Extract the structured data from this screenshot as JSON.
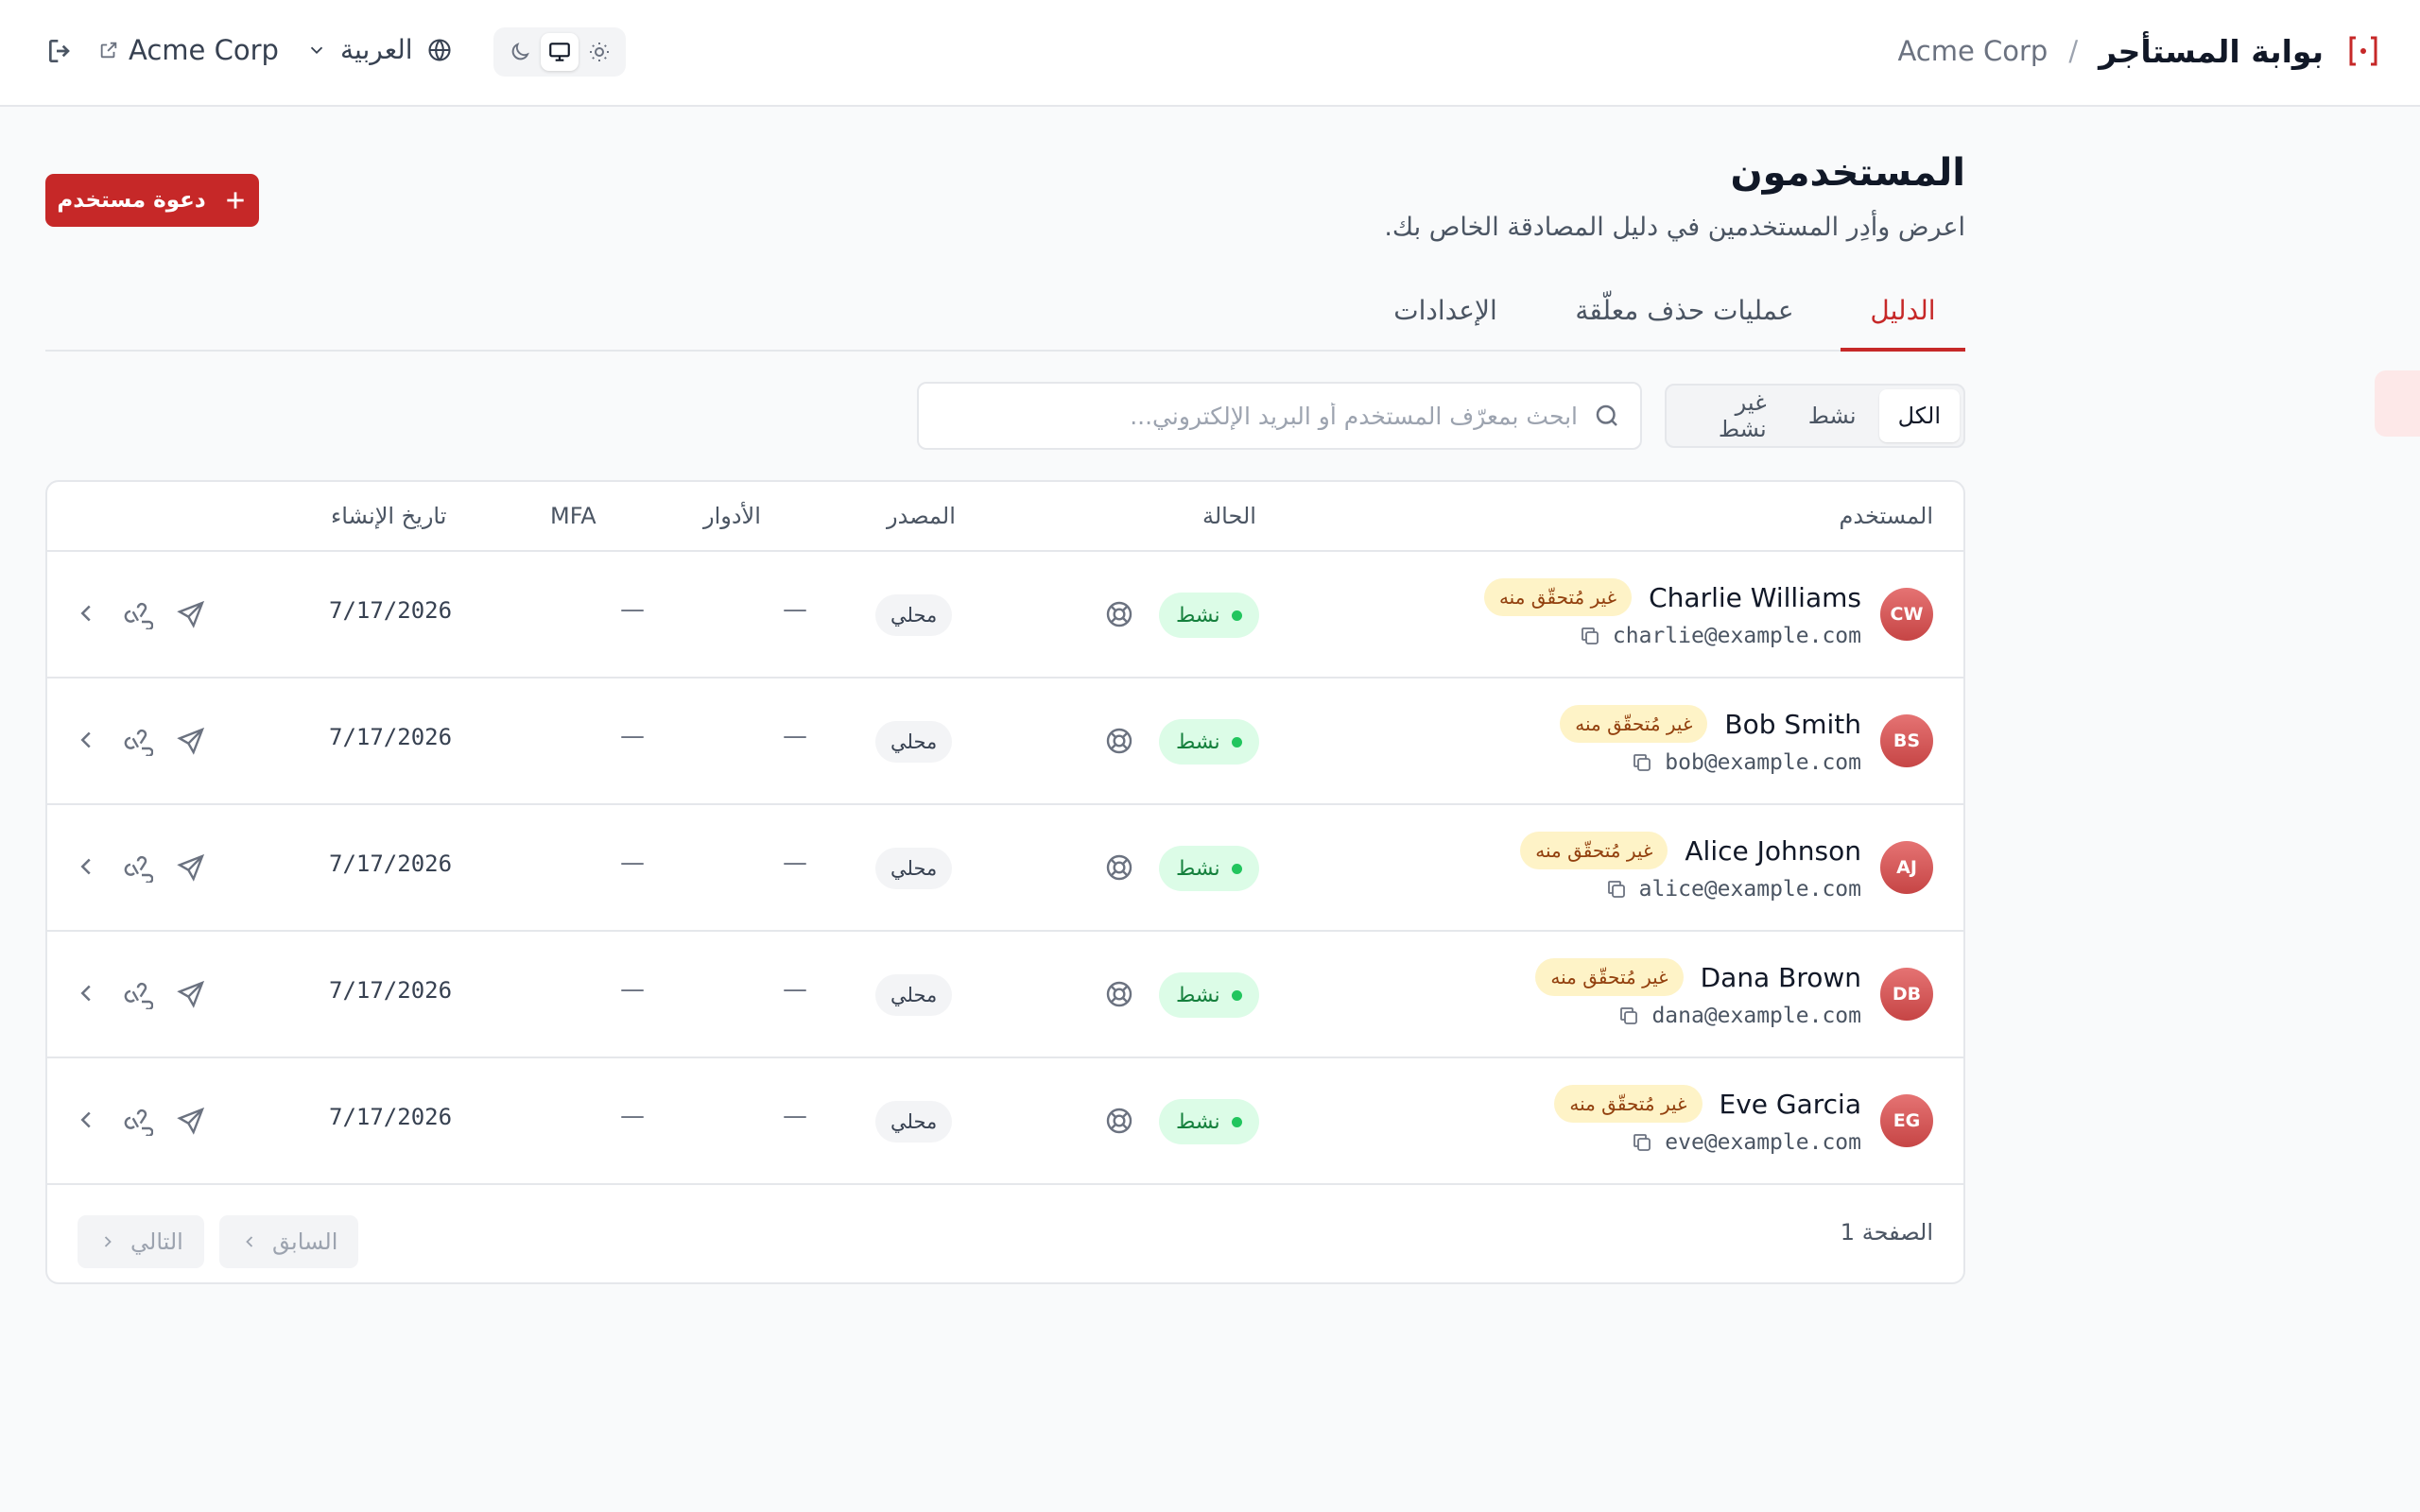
{
  "header": {
    "portal_title": "بوابة المستأجر",
    "separator": "/",
    "tenant": "Acme Corp",
    "language": "العربية",
    "tenant_link": "Acme Corp",
    "theme_options": [
      "light",
      "system",
      "dark"
    ],
    "theme_selected": "system"
  },
  "page": {
    "title": "المستخدمون",
    "subtitle": "اعرض وأدِر المستخدمين في دليل المصادقة الخاص بك.",
    "invite_button": "دعوة مستخدم"
  },
  "tabs": [
    {
      "label": "الدليل",
      "active": true
    },
    {
      "label": "عمليات حذف معلّقة",
      "active": false
    },
    {
      "label": "الإعدادات",
      "active": false
    }
  ],
  "filters": {
    "segments": [
      {
        "label": "الكل",
        "active": true
      },
      {
        "label": "نشط",
        "active": false
      },
      {
        "label": "غير نشط",
        "active": false
      }
    ],
    "search_placeholder": "ابحث بمعرّف المستخدم أو البريد الإلكتروني...",
    "search_value": ""
  },
  "table": {
    "columns": {
      "user": "المستخدم",
      "status": "الحالة",
      "source": "المصدر",
      "roles": "الأدوار",
      "mfa": "MFA",
      "created": "تاريخ الإنشاء"
    },
    "rows": [
      {
        "initials": "CW",
        "name": "Charlie Williams",
        "email": "charlie@example.com",
        "unverified": "غير مُتحقّق منه",
        "status": "نشط",
        "source": "محلي",
        "roles": "—",
        "mfa": "—",
        "created": "7/17/2026"
      },
      {
        "initials": "BS",
        "name": "Bob Smith",
        "email": "bob@example.com",
        "unverified": "غير مُتحقّق منه",
        "status": "نشط",
        "source": "محلي",
        "roles": "—",
        "mfa": "—",
        "created": "7/17/2026"
      },
      {
        "initials": "AJ",
        "name": "Alice Johnson",
        "email": "alice@example.com",
        "unverified": "غير مُتحقّق منه",
        "status": "نشط",
        "source": "محلي",
        "roles": "—",
        "mfa": "—",
        "created": "7/17/2026"
      },
      {
        "initials": "DB",
        "name": "Dana Brown",
        "email": "dana@example.com",
        "unverified": "غير مُتحقّق منه",
        "status": "نشط",
        "source": "محلي",
        "roles": "—",
        "mfa": "—",
        "created": "7/17/2026"
      },
      {
        "initials": "EG",
        "name": "Eve Garcia",
        "email": "eve@example.com",
        "unverified": "غير مُتحقّق منه",
        "status": "نشط",
        "source": "محلي",
        "roles": "—",
        "mfa": "—",
        "created": "7/17/2026"
      }
    ],
    "row_icons": [
      "copy-icon",
      "lifebuoy-icon",
      "send-icon",
      "webhook-icon",
      "chevron-left-icon"
    ]
  },
  "pagination": {
    "page_label": "الصفحة 1",
    "previous": "السابق",
    "next": "التالي"
  },
  "colors": {
    "accent": "#c62828",
    "status_active_bg": "#dcfce7",
    "status_active_text": "#15803d",
    "unverified_bg": "#fef3c7",
    "unverified_text": "#92400e"
  }
}
